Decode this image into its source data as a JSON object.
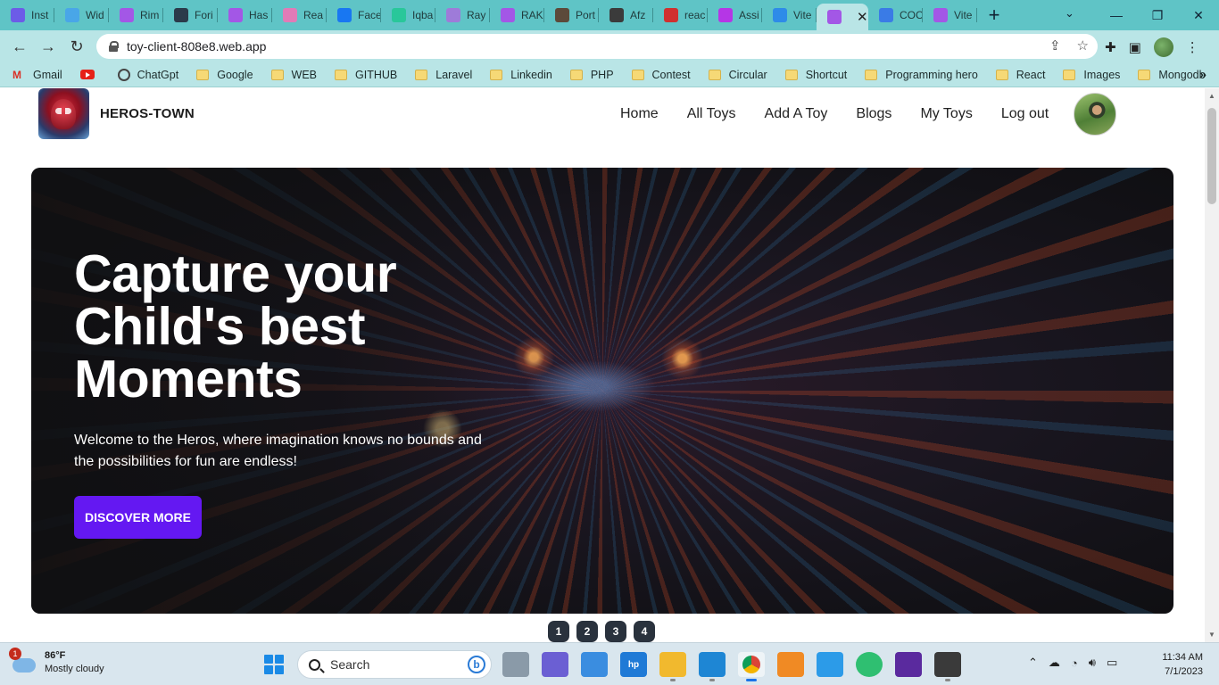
{
  "browser": {
    "tabs": [
      {
        "label": "Inst",
        "color": "#6c5ce7"
      },
      {
        "label": "Wid",
        "color": "#49a6e8"
      },
      {
        "label": "Rim",
        "color": "#a357e6"
      },
      {
        "label": "Fori",
        "color": "#2b3a4a"
      },
      {
        "label": "Has",
        "color": "#a357e6"
      },
      {
        "label": "Rea",
        "color": "#e17bb7"
      },
      {
        "label": "Face",
        "color": "#1877f2"
      },
      {
        "label": "Iqba",
        "color": "#29c79a"
      },
      {
        "label": "Ray",
        "color": "#9e7bd9"
      },
      {
        "label": "RAK",
        "color": "#a357e6"
      },
      {
        "label": "Port",
        "color": "#5c4a3a"
      },
      {
        "label": "Afz",
        "color": "#3b3b3b"
      },
      {
        "label": "reac",
        "color": "#d0302f"
      },
      {
        "label": "Assi",
        "color": "#b536e6"
      },
      {
        "label": "Vite",
        "color": "#2e8be8"
      },
      {
        "label": "",
        "color": "#a357e6",
        "active": true
      },
      {
        "label": "COC",
        "color": "#3a7be6"
      },
      {
        "label": "Vite",
        "color": "#a357e6"
      }
    ],
    "new_tab": "+",
    "url": "toy-client-808e8.web.app",
    "bookmarks": [
      {
        "label": "Gmail",
        "icon": "gmail-icon"
      },
      {
        "label": "",
        "icon": "youtube-icon"
      },
      {
        "label": "ChatGpt",
        "icon": "chatgpt-icon"
      },
      {
        "label": "Google",
        "icon": "folder-icon"
      },
      {
        "label": "WEB",
        "icon": "folder-icon"
      },
      {
        "label": "GITHUB",
        "icon": "folder-icon"
      },
      {
        "label": "Laravel",
        "icon": "folder-icon"
      },
      {
        "label": "Linkedin",
        "icon": "folder-icon"
      },
      {
        "label": "PHP",
        "icon": "folder-icon"
      },
      {
        "label": "Contest",
        "icon": "folder-icon"
      },
      {
        "label": "Circular",
        "icon": "folder-icon"
      },
      {
        "label": "Shortcut",
        "icon": "folder-icon"
      },
      {
        "label": "Programming hero",
        "icon": "folder-icon"
      },
      {
        "label": "React",
        "icon": "folder-icon"
      },
      {
        "label": "Images",
        "icon": "folder-icon"
      },
      {
        "label": "Mongodb",
        "icon": "folder-icon"
      }
    ]
  },
  "site": {
    "brand": "HEROS-TOWN",
    "menu": [
      "Home",
      "All Toys",
      "Add A Toy",
      "Blogs",
      "My Toys",
      "Log out"
    ],
    "hero": {
      "title": "Capture your Child's best Moments",
      "text": "Welcome to the Heros, where imagination knows no bounds and the possibilities for fun are endless!",
      "button": "DISCOVER MORE"
    },
    "slides": [
      "1",
      "2",
      "3",
      "4"
    ]
  },
  "taskbar": {
    "weather_temp": "86°F",
    "weather_desc": "Mostly cloudy",
    "weather_badge": "1",
    "search_placeholder": "Search",
    "time": "11:34 AM",
    "date": "7/1/2023"
  },
  "colors": {
    "browser_frame": "#5fc4c6",
    "accent_button": "#6418f2",
    "slide_dot": "#2a323d"
  }
}
